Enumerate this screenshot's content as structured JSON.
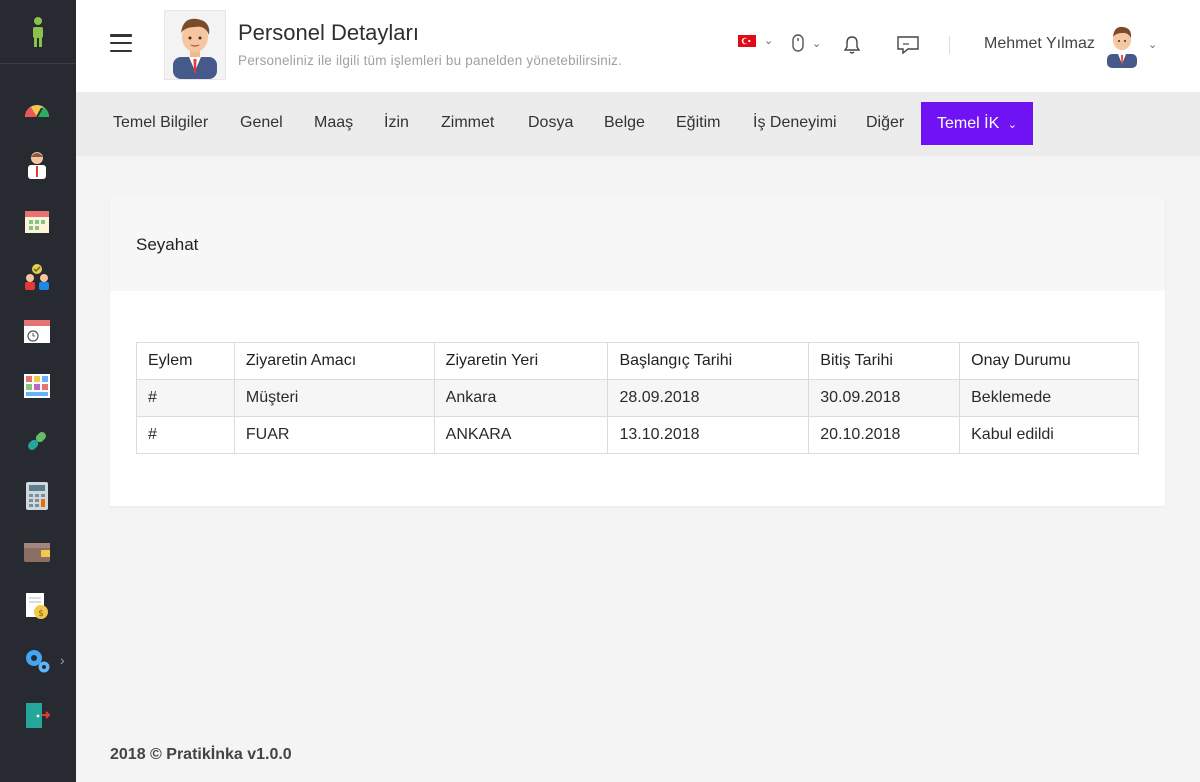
{
  "header": {
    "title": "Personel Detayları",
    "subtitle": "Personeliniz ile ilgili tüm işlemleri bu panelden yönetebilirsiniz.",
    "user_name": "Mehmet Yılmaz"
  },
  "sidebar": {
    "icons": [
      "person-logo-icon",
      "dashboard-gauge-icon",
      "employee-icon",
      "calendar-icon",
      "team-icon",
      "calendar-clock-icon",
      "tiles-icon",
      "pill-icon",
      "calculator-icon",
      "wallet-icon",
      "document-coin-icon",
      "settings-gears-icon",
      "exit-door-icon"
    ]
  },
  "tabs": [
    {
      "label": "Temel Bilgiler"
    },
    {
      "label": "Genel"
    },
    {
      "label": "Maaş"
    },
    {
      "label": "İzin"
    },
    {
      "label": "Zimmet"
    },
    {
      "label": "Dosya"
    },
    {
      "label": "Belge"
    },
    {
      "label": "Eğitim"
    },
    {
      "label": "İş Deneyimi"
    },
    {
      "label": "Diğer"
    },
    {
      "label": "Temel İK"
    }
  ],
  "card": {
    "title": "Seyahat",
    "columns": [
      "Eylem",
      "Ziyaretin Amacı",
      "Ziyaretin Yeri",
      "Başlangıç Tarihi",
      "Bitiş Tarihi",
      "Onay Durumu"
    ],
    "rows": [
      [
        "#",
        "Müşteri",
        "Ankara",
        "28.09.2018",
        "30.09.2018",
        "Beklemede"
      ],
      [
        "#",
        "FUAR",
        "ANKARA",
        "13.10.2018",
        "20.10.2018",
        "Kabul edildi"
      ]
    ]
  },
  "footer": {
    "text": "2018 © Pratikİnka v1.0.0"
  },
  "colors": {
    "accent": "#6f13f4",
    "sidebar": "#272a31"
  }
}
